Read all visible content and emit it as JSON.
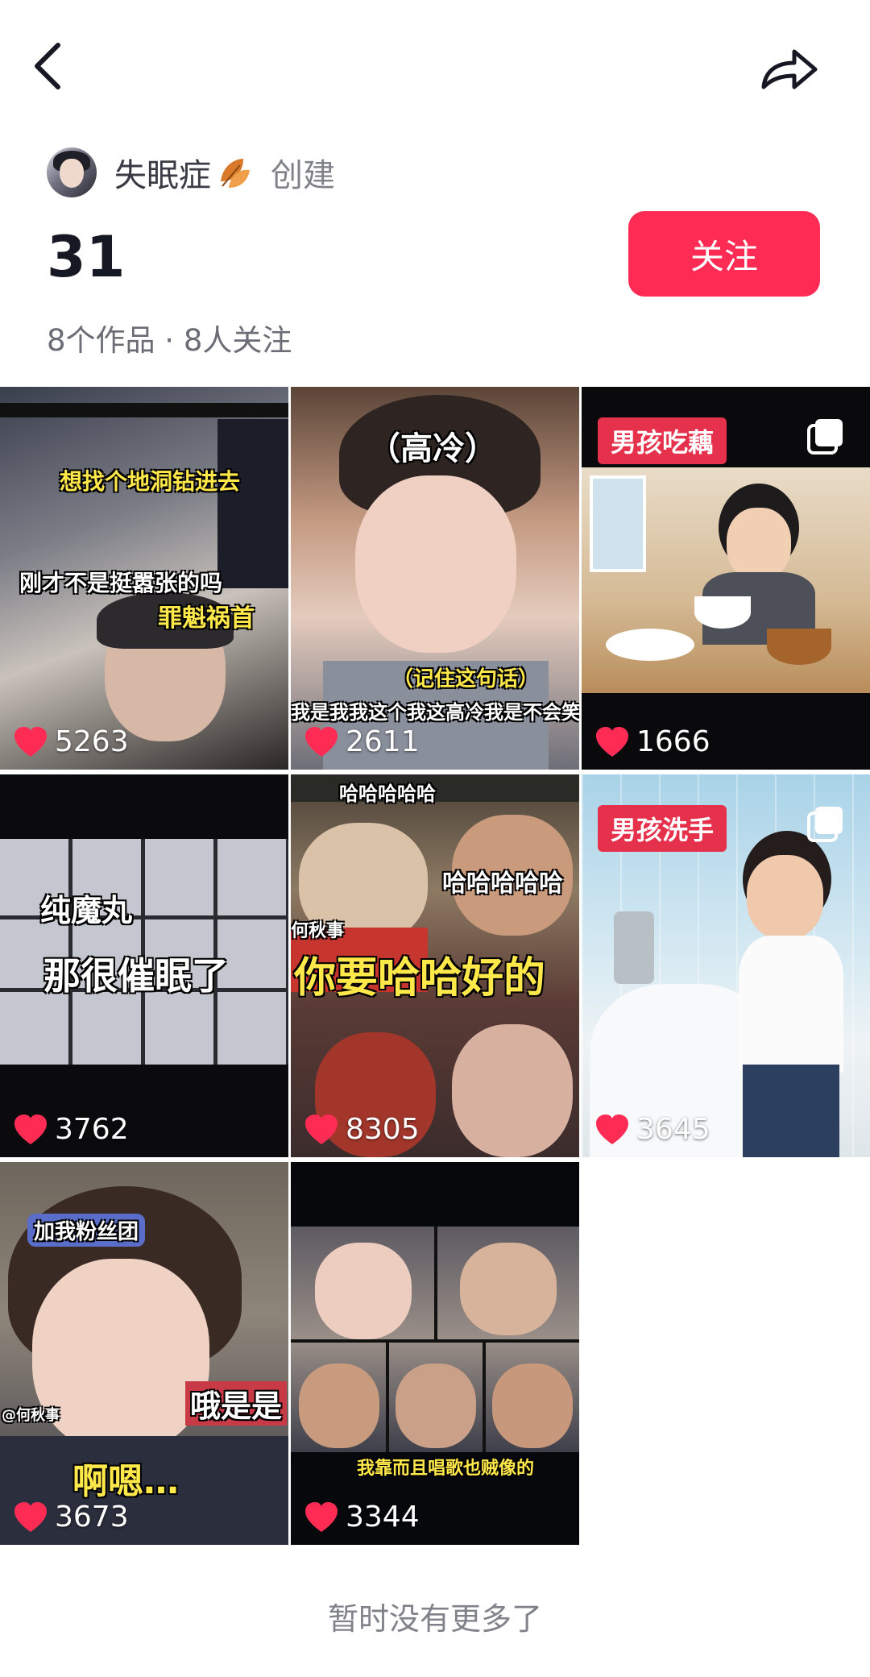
{
  "header": {
    "back_icon": "chevron-left-icon",
    "share_icon": "share-arrow-icon"
  },
  "creator": {
    "name": "失眠症",
    "badge_icon": "autumn-leaves-icon",
    "suffix": "创建"
  },
  "collection": {
    "title": "31",
    "follow_label": "关注",
    "stats": "8个作品 · 8人关注"
  },
  "accent_color": "#fe2c55",
  "videos": [
    {
      "likes": "5263",
      "captions": [
        "想找个地洞钻进去",
        "刚才不是挺嚣张的吗",
        "罪魁祸首"
      ]
    },
    {
      "likes": "2611",
      "captions": [
        "（高冷）",
        "（记住这句话）",
        "我是我我这个我这高冷我是不会笑的"
      ]
    },
    {
      "likes": "1666",
      "tag": "男孩吃藕",
      "multi_image": true
    },
    {
      "likes": "3762",
      "captions": [
        "纯魔丸",
        "那很催眠了"
      ]
    },
    {
      "likes": "8305",
      "captions": [
        "哈哈哈哈哈",
        "哈哈哈哈哈",
        "你要哈哈好的",
        "何秋事"
      ]
    },
    {
      "likes": "3645",
      "tag": "男孩洗手",
      "multi_image": true
    },
    {
      "likes": "3673",
      "captions": [
        "加我粉丝团",
        "哦是是",
        "啊嗯…",
        "@何秋事"
      ]
    },
    {
      "likes": "3344",
      "captions": [
        "我靠而且唱歌也贼像的"
      ]
    }
  ],
  "footer": {
    "text": "暂时没有更多了"
  }
}
